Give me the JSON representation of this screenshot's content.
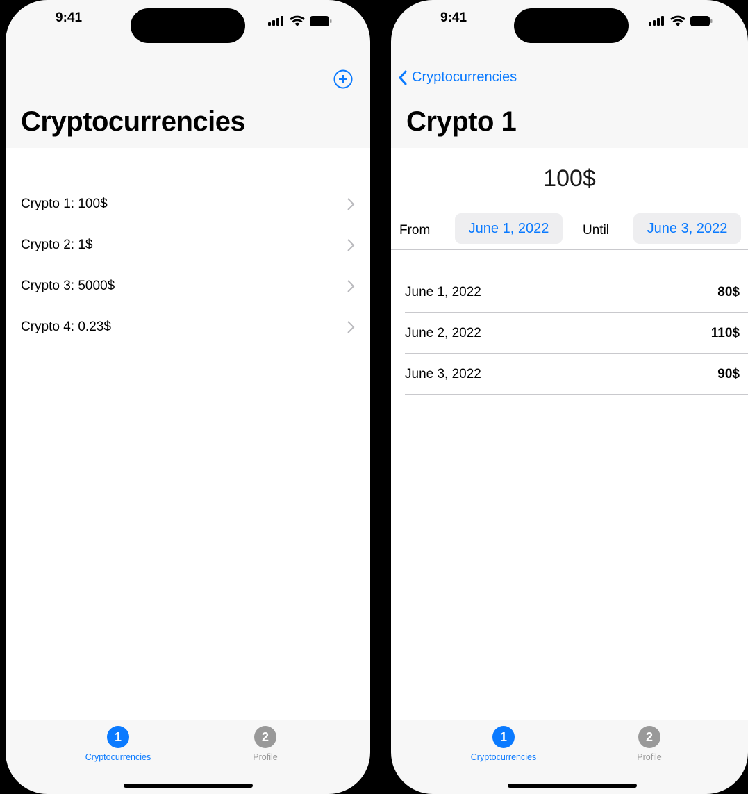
{
  "status": {
    "time": "9:41"
  },
  "list_screen": {
    "title": "Cryptocurrencies",
    "add_icon": "plus-circle-icon",
    "items": [
      {
        "label": "Crypto 1: 100$"
      },
      {
        "label": "Crypto 2: 1$"
      },
      {
        "label": "Crypto 3: 5000$"
      },
      {
        "label": "Crypto 4: 0.23$"
      }
    ]
  },
  "detail_screen": {
    "back_label": "Cryptocurrencies",
    "title": "Crypto 1",
    "price": "100$",
    "from_label": "From",
    "from_date": "June 1, 2022",
    "until_label": "Until",
    "until_date": "June 3, 2022",
    "history": [
      {
        "date": "June 1, 2022",
        "value": "80$"
      },
      {
        "date": "June 2, 2022",
        "value": "110$"
      },
      {
        "date": "June 3, 2022",
        "value": "90$"
      }
    ]
  },
  "tabbar": {
    "tabs": [
      {
        "badge": "1",
        "label": "Cryptocurrencies",
        "selected": true
      },
      {
        "badge": "2",
        "label": "Profile",
        "selected": false
      }
    ]
  },
  "colors": {
    "accent": "#0a7aff",
    "inactive": "#999999"
  }
}
